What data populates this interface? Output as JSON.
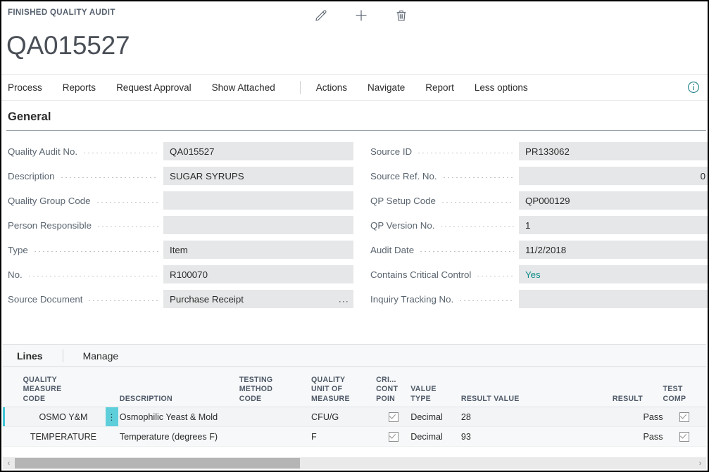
{
  "header": {
    "breadcrumb": "FINISHED QUALITY AUDIT",
    "record_title": "QA015527",
    "icons": [
      {
        "name": "edit-pencil-icon",
        "label": "Edit"
      },
      {
        "name": "new-plus-icon",
        "label": "New"
      },
      {
        "name": "delete-trash-icon",
        "label": "Delete"
      }
    ]
  },
  "action_bar": {
    "items": [
      {
        "label": "Process"
      },
      {
        "label": "Reports"
      },
      {
        "label": "Request Approval"
      },
      {
        "label": "Show Attached"
      }
    ],
    "items_right": [
      {
        "label": "Actions"
      },
      {
        "label": "Navigate"
      },
      {
        "label": "Report"
      },
      {
        "label": "Less options"
      }
    ],
    "info_icon": "info-circle-icon"
  },
  "general": {
    "title": "General",
    "left_fields": [
      {
        "label": "Quality Audit No.",
        "value": "QA015527"
      },
      {
        "label": "Description",
        "value": "SUGAR SYRUPS"
      },
      {
        "label": "Quality Group Code",
        "value": ""
      },
      {
        "label": "Person Responsible",
        "value": ""
      },
      {
        "label": "Type",
        "value": "Item"
      },
      {
        "label": "No.",
        "value": "R100070"
      },
      {
        "label": "Source Document",
        "value": "Purchase Receipt",
        "has_ellipsis": true,
        "ellipsis": "..."
      }
    ],
    "right_fields": [
      {
        "label": "Source ID",
        "value": "PR133062"
      },
      {
        "label": "Source Ref. No.",
        "value": "0",
        "numeric": true
      },
      {
        "label": "QP Setup Code",
        "value": "QP000129"
      },
      {
        "label": "QP Version No.",
        "value": "1"
      },
      {
        "label": "Audit Date",
        "value": "11/2/2018"
      },
      {
        "label": "Contains Critical Control",
        "value": "Yes",
        "accent": true
      },
      {
        "label": "Inquiry Tracking No.",
        "value": ""
      }
    ]
  },
  "lines": {
    "tabs": [
      {
        "label": "Lines",
        "active": true
      },
      {
        "label": "Manage",
        "active": false
      }
    ],
    "columns": [
      {
        "key": "quality_measure_code",
        "lines": [
          "QUALITY",
          "MEASURE",
          "CODE"
        ],
        "align": "left"
      },
      {
        "key": "description",
        "lines": [
          "",
          "",
          "DESCRIPTION"
        ],
        "align": "left"
      },
      {
        "key": "testing_method_code",
        "lines": [
          "TESTING",
          "METHOD",
          "CODE"
        ],
        "align": "left"
      },
      {
        "key": "quality_unit_of_measure",
        "lines": [
          "QUALITY",
          "UNIT OF",
          "MEASURE"
        ],
        "align": "left"
      },
      {
        "key": "critical_control_point",
        "lines": [
          "CRI...",
          "CONT",
          "POIN"
        ],
        "align": "left"
      },
      {
        "key": "value_type",
        "lines": [
          "",
          "VALUE",
          "TYPE"
        ],
        "align": "left"
      },
      {
        "key": "result_value",
        "lines": [
          "",
          "",
          "RESULT VALUE"
        ],
        "align": "left"
      },
      {
        "key": "result",
        "lines": [
          "",
          "",
          "RESULT"
        ],
        "align": "right"
      },
      {
        "key": "test_complete",
        "lines": [
          "",
          "TEST",
          "COMP"
        ],
        "align": "left"
      }
    ],
    "rows": [
      {
        "selected": true,
        "handle_icon": "row-menu-dots-icon",
        "quality_measure_code": "OSMO Y&M",
        "description": "Osmophilic Yeast & Mold",
        "testing_method_code": "",
        "quality_unit_of_measure": "CFU/G",
        "critical_control_point": true,
        "value_type": "Decimal",
        "result_value": "28",
        "result": "Pass",
        "test_complete": true
      },
      {
        "selected": false,
        "handle_icon": "row-menu-dots-icon",
        "quality_measure_code": "TEMPERATURE",
        "description": "Temperature (degrees F)",
        "testing_method_code": "",
        "quality_unit_of_measure": "F",
        "critical_control_point": true,
        "value_type": "Decimal",
        "result_value": "93",
        "result": "Pass",
        "test_complete": true
      }
    ],
    "scrollbar": {
      "left_arrow": "‹",
      "right_arrow": "›",
      "thumb_percent": 42
    }
  },
  "colors": {
    "accent_teal": "#0f8b8b",
    "row_handle": "#5ecfda",
    "field_bg": "#e6e7e8",
    "label_text": "#5a6570",
    "header_text": "#4e5968"
  }
}
